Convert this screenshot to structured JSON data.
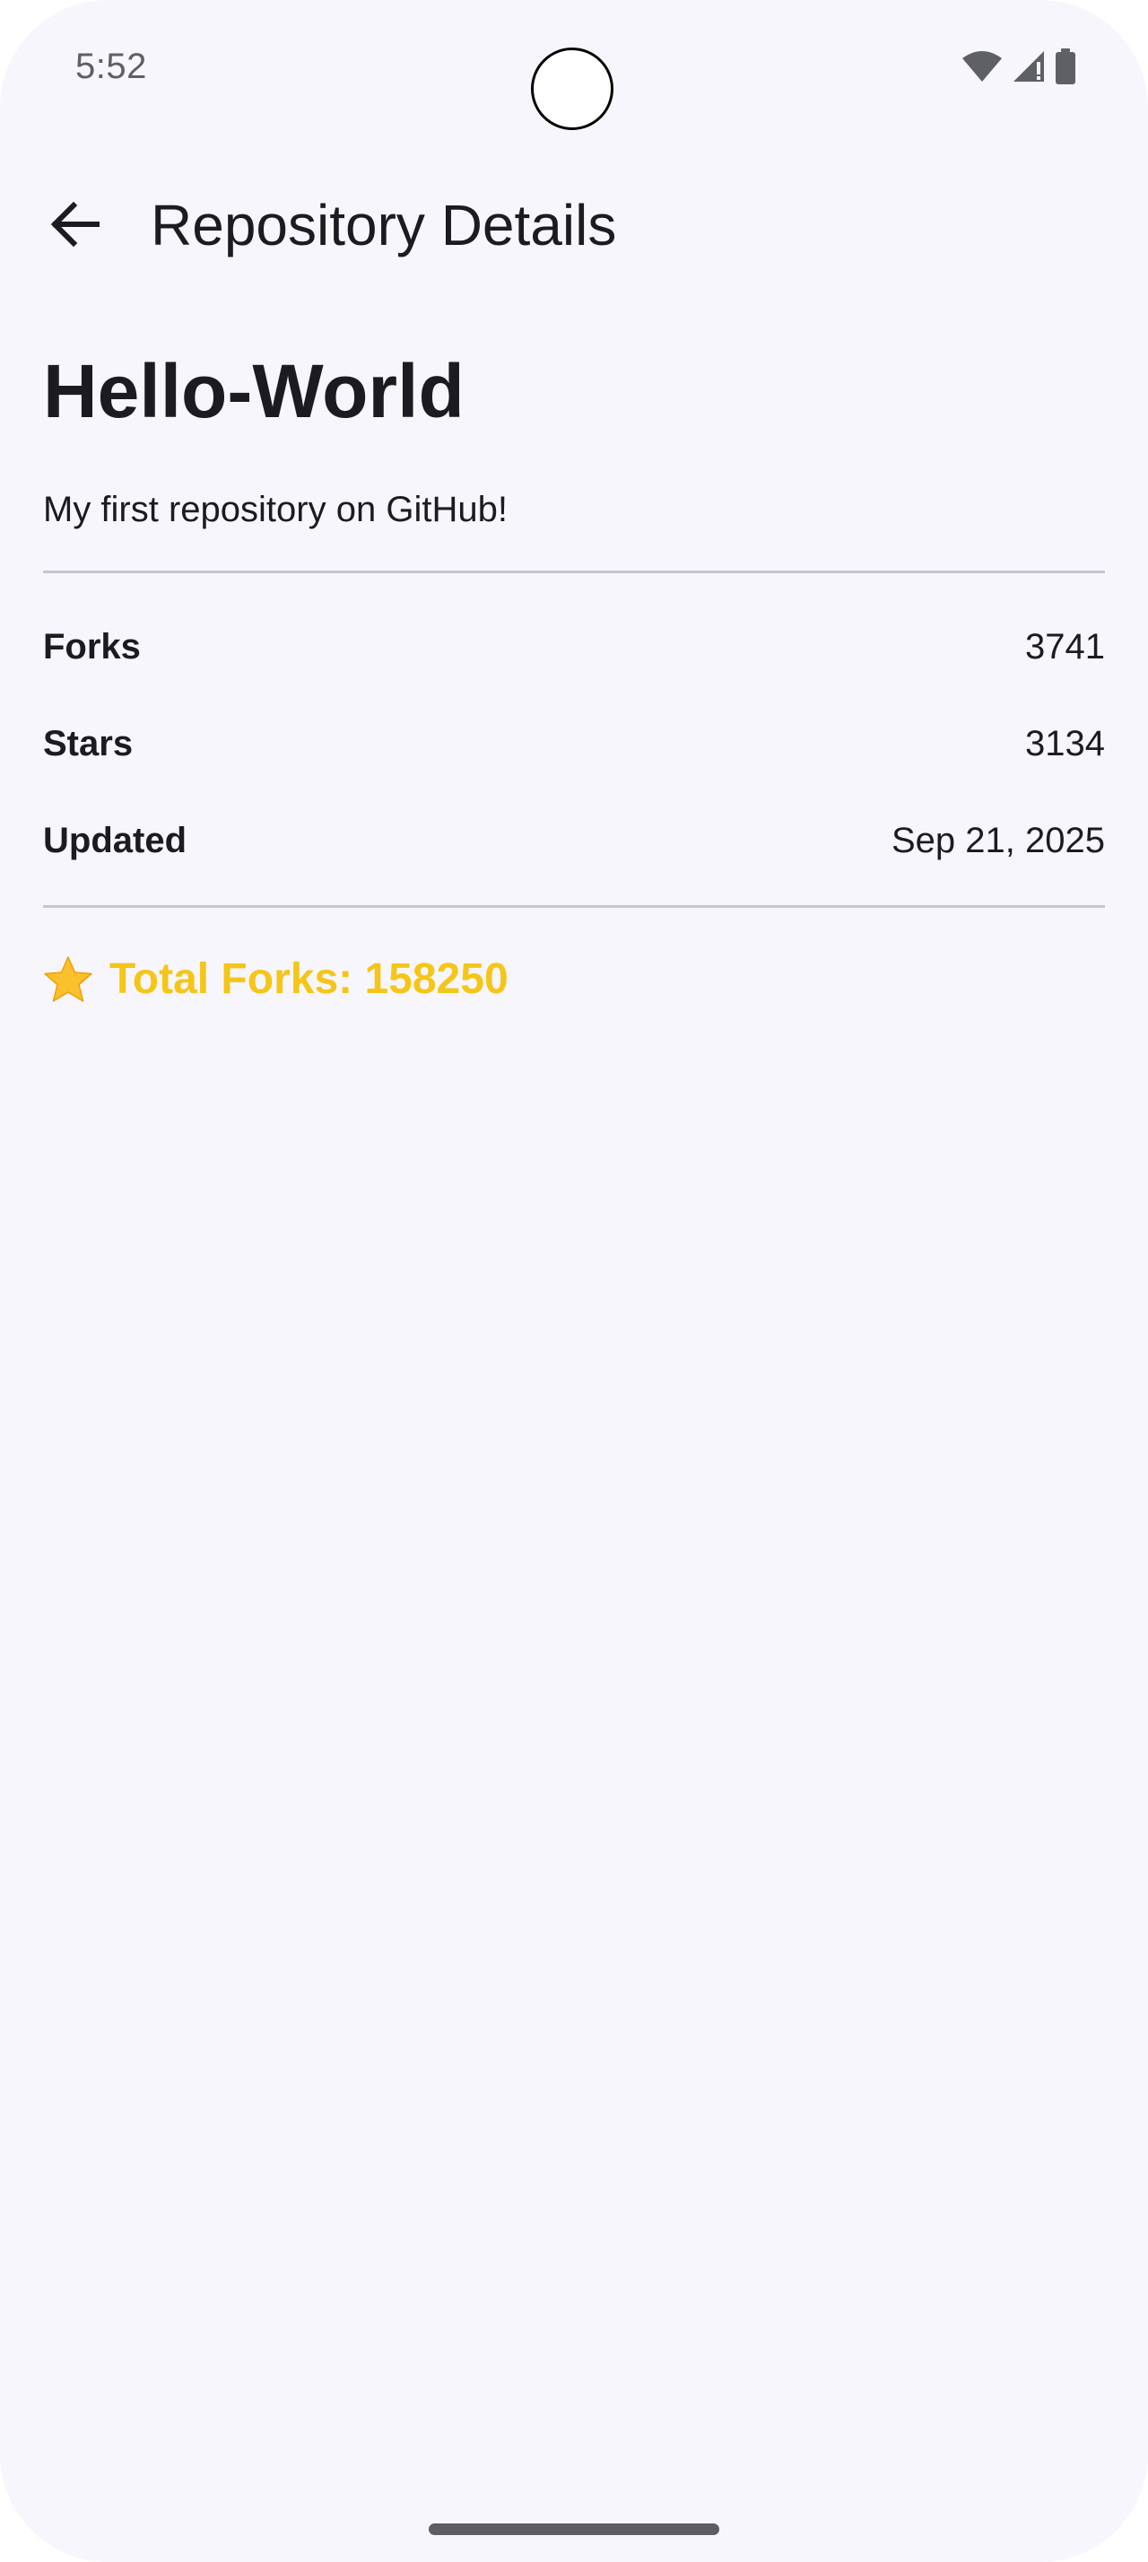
{
  "status_bar": {
    "time": "5:52",
    "icons": [
      "wifi-icon",
      "signal-icon",
      "battery-icon"
    ]
  },
  "app_bar": {
    "back_icon": "arrow-left-icon",
    "title": "Repository Details"
  },
  "repository": {
    "name": "Hello-World",
    "description": "My first repository on GitHub!",
    "stats": [
      {
        "label": "Forks",
        "value": "3741"
      },
      {
        "label": "Stars",
        "value": "3134"
      },
      {
        "label": "Updated",
        "value": "Sep 21, 2025"
      }
    ],
    "total_forks": "Total Forks: 158250"
  },
  "colors": {
    "background": "#f7f6fc",
    "text": "#1c1b1f",
    "divider": "#c7c6cd",
    "accent_gold": "#f5c518"
  }
}
